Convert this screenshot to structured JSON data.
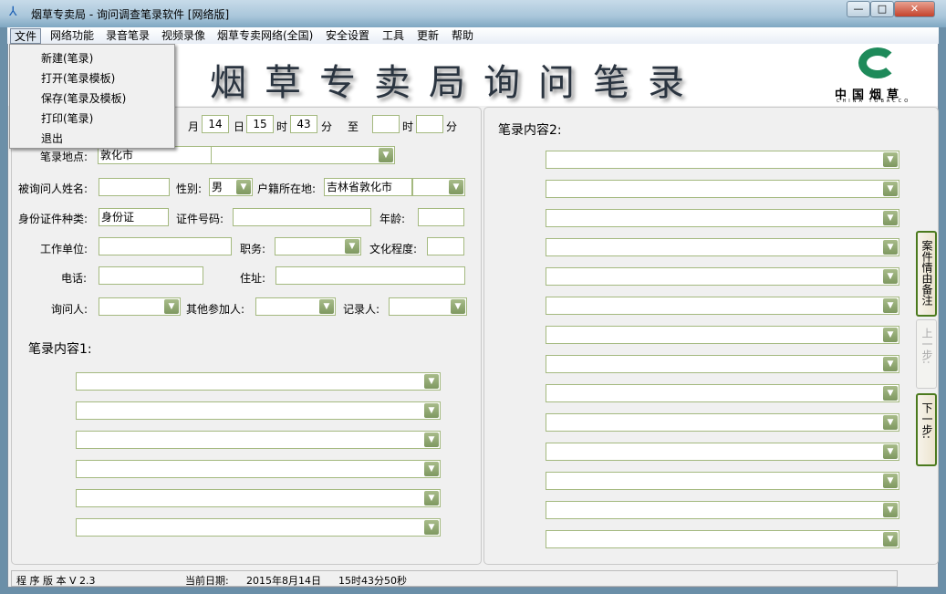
{
  "window": {
    "title": "烟草专卖局 - 询问调查笔录软件  [网络版]",
    "min": "—",
    "max": "□",
    "close": "✕"
  },
  "menubar": [
    "文件",
    "网络功能",
    "录音笔录",
    "视频录像",
    "烟草专卖网络(全国)",
    "安全设置",
    "工具",
    "更新",
    "帮助"
  ],
  "file_menu": [
    "新建(笔录)",
    "打开(笔录模板)",
    "保存(笔录及模板)",
    "打印(笔录)",
    "退出"
  ],
  "banner": {
    "title": "烟草专卖局询问笔录",
    "logo_text": "中国烟草",
    "logo_sub": "CHINA TOBACCO"
  },
  "form": {
    "time_row": {
      "month_label": "月",
      "day": "14",
      "day_label": "日",
      "hour": "15",
      "hour_label": "时",
      "minute": "43",
      "minute_label": "分",
      "to_label": "至",
      "end_hour": "",
      "end_hour_label": "时",
      "end_minute": "",
      "end_minute_label": "分"
    },
    "location_label": "笔录地点:",
    "location": "敦化市",
    "name_label": "被询问人姓名:",
    "name": "",
    "gender_label": "性别:",
    "gender": "男",
    "domicile_label": "户籍所在地:",
    "domicile": "吉林省敦化市",
    "id_type_label": "身份证件种类:",
    "id_type": "身份证",
    "id_no_label": "证件号码:",
    "id_no": "",
    "age_label": "年龄:",
    "age": "",
    "employer_label": "工作单位:",
    "employer": "",
    "position_label": "职务:",
    "position": "",
    "education_label": "文化程度:",
    "education": "",
    "phone_label": "电话:",
    "phone": "",
    "address_label": "住址:",
    "address": "",
    "interviewer_label": "询问人:",
    "others_label": "其他参加人:",
    "recorder_label": "记录人:"
  },
  "content1_label": "笔录内容1:",
  "content2_label": "笔录内容2:",
  "side_buttons": {
    "case_note": "案件情由备注",
    "prev": "上一步:",
    "next": "下一步:"
  },
  "status": {
    "version": "程 序 版 本 V 2.3",
    "date_label": "当前日期:",
    "date": "2015年8月14日",
    "time": "15时43分50秒"
  }
}
